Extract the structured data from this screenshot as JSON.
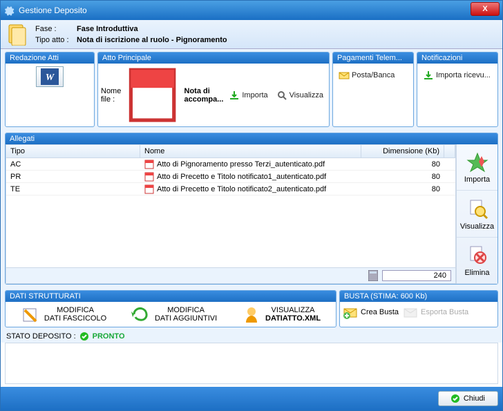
{
  "window": {
    "title": "Gestione Deposito",
    "close": "X"
  },
  "header": {
    "fase_label": "Fase :",
    "fase_val": "Fase Introduttiva",
    "tipo_label": "Tipo atto :",
    "tipo_val": "Nota di iscrizione al ruolo - Pignoramento"
  },
  "panels": {
    "redazione": {
      "title": "Redazione Atti"
    },
    "atto": {
      "title": "Atto Principale",
      "nome_label": "Nome file :",
      "nome_val": "Nota di accompa...",
      "importa": "Importa",
      "visualizza": "Visualizza"
    },
    "pagamenti": {
      "title": "Pagamenti Telem...",
      "posta": "Posta/Banca"
    },
    "notificazioni": {
      "title": "Notificazioni",
      "importa": "Importa ricevu..."
    }
  },
  "allegati": {
    "title": "Allegati",
    "cols": {
      "tipo": "Tipo",
      "nome": "Nome",
      "dim": "Dimensione (Kb)"
    },
    "rows": [
      {
        "tipo": "AC",
        "nome": "Atto di Pignoramento presso Terzi_autenticato.pdf",
        "dim": "80"
      },
      {
        "tipo": "PR",
        "nome": "Atto di Precetto e Titolo notificato1_autenticato.pdf",
        "dim": "80"
      },
      {
        "tipo": "TE",
        "nome": "Atto di Precetto e Titolo notificato2_autenticato.pdf",
        "dim": "80"
      }
    ],
    "side": {
      "importa": "Importa",
      "visualizza": "Visualizza",
      "elimina": "Elimina"
    },
    "total": "240"
  },
  "dati": {
    "title": "DATI STRUTTURATI",
    "b1a": "MODIFICA",
    "b1b": "DATI FASCICOLO",
    "b2a": "MODIFICA",
    "b2b": "DATI AGGIUNTIVI",
    "b3a": "VISUALIZZA",
    "b3b": "DATIATTO.XML"
  },
  "busta": {
    "title": "BUSTA (STIMA: 600 Kb)",
    "crea": "Crea Busta",
    "esporta": "Esporta Busta"
  },
  "status": {
    "label": "STATO DEPOSITO :",
    "val": "PRONTO"
  },
  "footer": {
    "chiudi": "Chiudi"
  }
}
